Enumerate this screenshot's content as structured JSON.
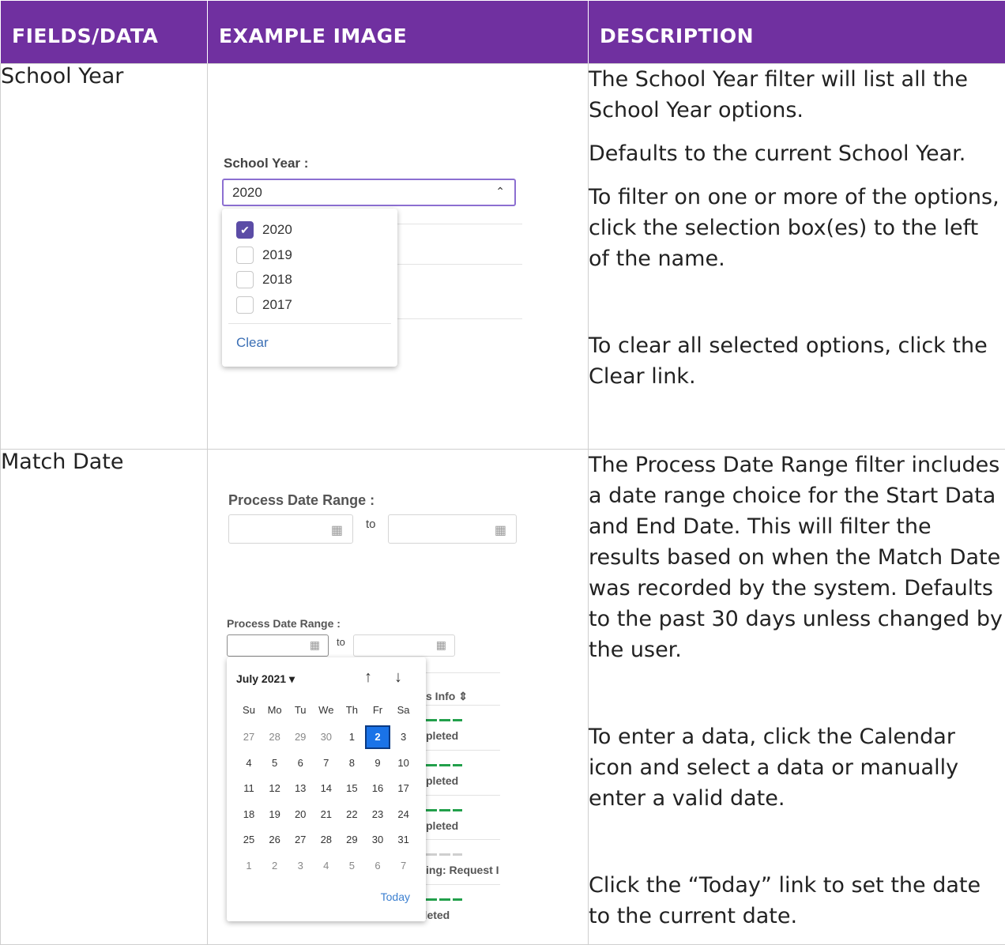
{
  "headers": {
    "col1": "FIELDS/DATA",
    "col2": "EXAMPLE IMAGE",
    "col3": "DESCRIPTION"
  },
  "row1": {
    "field": "School Year",
    "mock": {
      "label": "School Year :",
      "selected": "2020",
      "options": [
        {
          "label": "2020",
          "checked": true
        },
        {
          "label": "2019",
          "checked": false
        },
        {
          "label": "2018",
          "checked": false
        },
        {
          "label": "2017",
          "checked": false
        }
      ],
      "clear": "Clear"
    },
    "desc": [
      "The School Year filter will list all the School Year options.",
      "Defaults to the current School Year.",
      "To filter on one or more of the options, click the selection box(es) to the left of the name.",
      "To clear all selected options, click the Clear link."
    ]
  },
  "row2": {
    "field": "Match Date",
    "mock": {
      "label1": "Process Date Range :",
      "to1": "to",
      "label2": "Process Date Range :",
      "to2": "to",
      "bg": {
        "header": "s Info",
        "rows": [
          "pleted",
          "pleted",
          "pleted",
          "ing: Request I",
          "ompleted"
        ]
      },
      "calendar": {
        "month": "July 2021",
        "dow": [
          "Su",
          "Mo",
          "Tu",
          "We",
          "Th",
          "Fr",
          "Sa"
        ],
        "weeks": [
          [
            "27",
            "28",
            "29",
            "30",
            "1",
            "2",
            "3"
          ],
          [
            "4",
            "5",
            "6",
            "7",
            "8",
            "9",
            "10"
          ],
          [
            "11",
            "12",
            "13",
            "14",
            "15",
            "16",
            "17"
          ],
          [
            "18",
            "19",
            "20",
            "21",
            "22",
            "23",
            "24"
          ],
          [
            "25",
            "26",
            "27",
            "28",
            "29",
            "30",
            "31"
          ],
          [
            "1",
            "2",
            "3",
            "4",
            "5",
            "6",
            "7"
          ]
        ],
        "selected_day": "2",
        "today": "Today"
      }
    },
    "desc": [
      "The Process Date Range filter includes a date range choice for the Start Data and End Date. This will filter the results based on when the Match Date was recorded by the system. Defaults to the past 30 days unless changed by the user.",
      "To enter a data, click the Calendar icon and select a data or manually enter a valid date.",
      "Click the “Today” link to set the date to the current date."
    ]
  }
}
